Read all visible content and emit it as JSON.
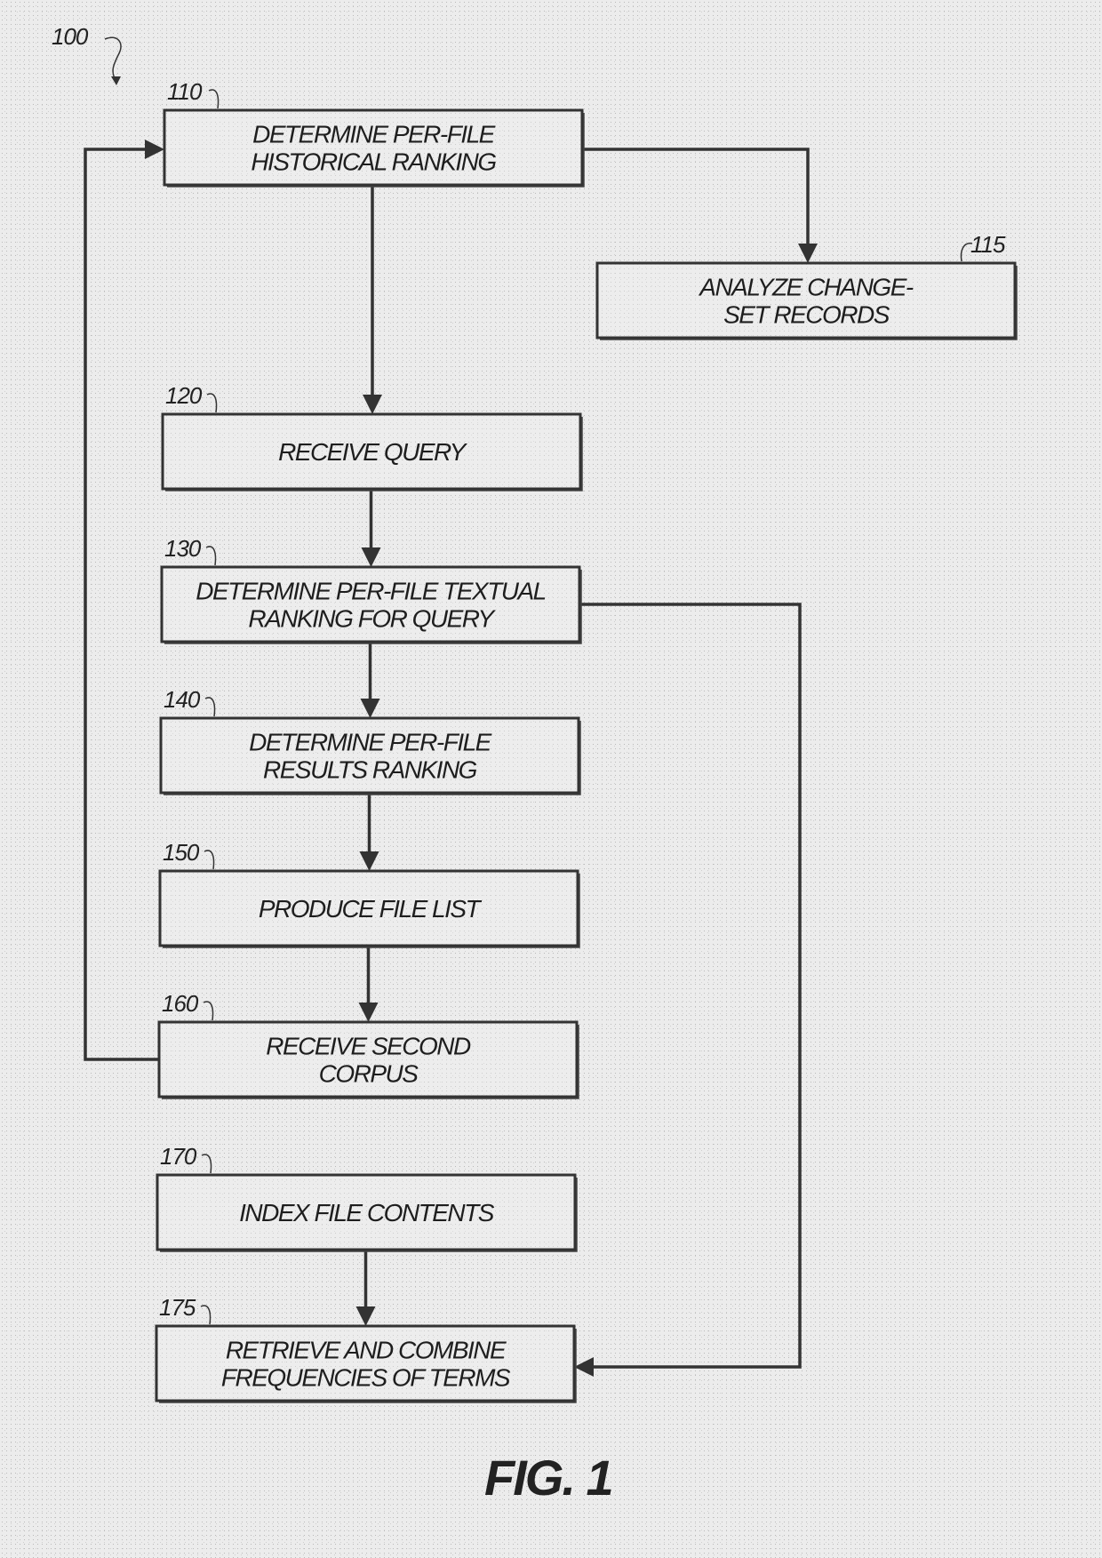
{
  "figure": {
    "reference": "100",
    "caption": "FIG. 1"
  },
  "steps": [
    {
      "id": "110",
      "lines": [
        "DETERMINE PER-FILE",
        "HISTORICAL RANKING"
      ]
    },
    {
      "id": "115",
      "lines": [
        "ANALYZE CHANGE-",
        "SET RECORDS"
      ]
    },
    {
      "id": "120",
      "lines": [
        "RECEIVE QUERY"
      ]
    },
    {
      "id": "130",
      "lines": [
        "DETERMINE PER-FILE TEXTUAL",
        "RANKING FOR QUERY"
      ]
    },
    {
      "id": "140",
      "lines": [
        "DETERMINE PER-FILE",
        "RESULTS RANKING"
      ]
    },
    {
      "id": "150",
      "lines": [
        "PRODUCE FILE LIST"
      ]
    },
    {
      "id": "160",
      "lines": [
        "RECEIVE SECOND",
        "CORPUS"
      ]
    },
    {
      "id": "170",
      "lines": [
        "INDEX FILE CONTENTS"
      ]
    },
    {
      "id": "175",
      "lines": [
        "RETRIEVE AND COMBINE",
        "FREQUENCIES OF TERMS"
      ]
    }
  ],
  "connections": [
    {
      "from": "110",
      "to": "115"
    },
    {
      "from": "110",
      "to": "120"
    },
    {
      "from": "120",
      "to": "130"
    },
    {
      "from": "130",
      "to": "140"
    },
    {
      "from": "140",
      "to": "150"
    },
    {
      "from": "150",
      "to": "160"
    },
    {
      "from": "160",
      "to": "110"
    },
    {
      "from": "130",
      "to": "175"
    },
    {
      "from": "170",
      "to": "175"
    }
  ]
}
